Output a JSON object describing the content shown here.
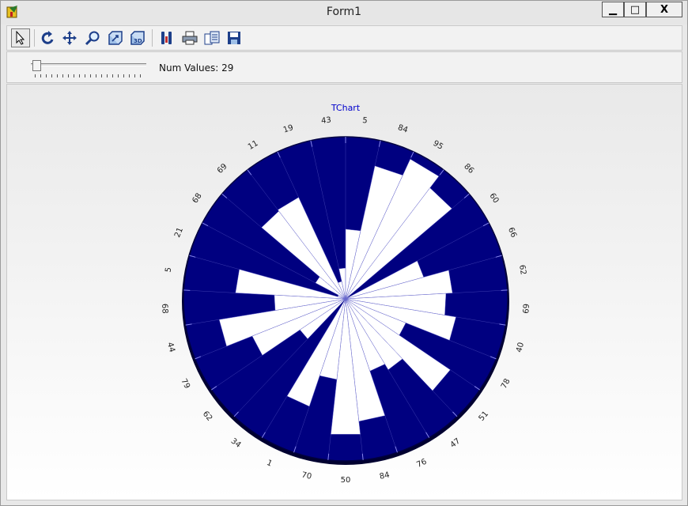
{
  "window": {
    "title": "Form1",
    "minimize_glyph": "▁",
    "maximize_glyph": "□",
    "close_glyph": "X"
  },
  "toolbar": {
    "buttons": [
      {
        "icon": "pointer-icon",
        "active": true
      },
      {
        "icon": "rotate-icon"
      },
      {
        "icon": "move-icon"
      },
      {
        "icon": "zoom-icon"
      },
      {
        "icon": "depth-icon"
      },
      {
        "icon": "3d-icon"
      },
      {
        "icon": "edit-icon"
      },
      {
        "icon": "print-icon"
      },
      {
        "icon": "copy-icon"
      },
      {
        "icon": "save-icon"
      }
    ]
  },
  "controls": {
    "slider_value": 0,
    "num_values_label": "Num Values: 29"
  },
  "chart_data": {
    "type": "polar-bar",
    "title": "TChart",
    "labels": [
      "5",
      "84",
      "95",
      "86",
      "60",
      "66",
      "62",
      "69",
      "40",
      "78",
      "51",
      "47",
      "76",
      "84",
      "50",
      "70",
      "1",
      "34",
      "62",
      "79",
      "44",
      "68",
      "5",
      "21",
      "68",
      "69",
      "11",
      "19",
      "43"
    ],
    "values": [
      0,
      84,
      95,
      86,
      0,
      50,
      66,
      62,
      69,
      40,
      78,
      51,
      47,
      76,
      84,
      50,
      70,
      1,
      34,
      62,
      79,
      44,
      68,
      5,
      21,
      68,
      69,
      11,
      19,
      43
    ],
    "colors": {
      "background": "#000080",
      "bar": "#ffffff",
      "title": "#0000cc",
      "gridline": "#6666cc"
    },
    "grid": true
  }
}
